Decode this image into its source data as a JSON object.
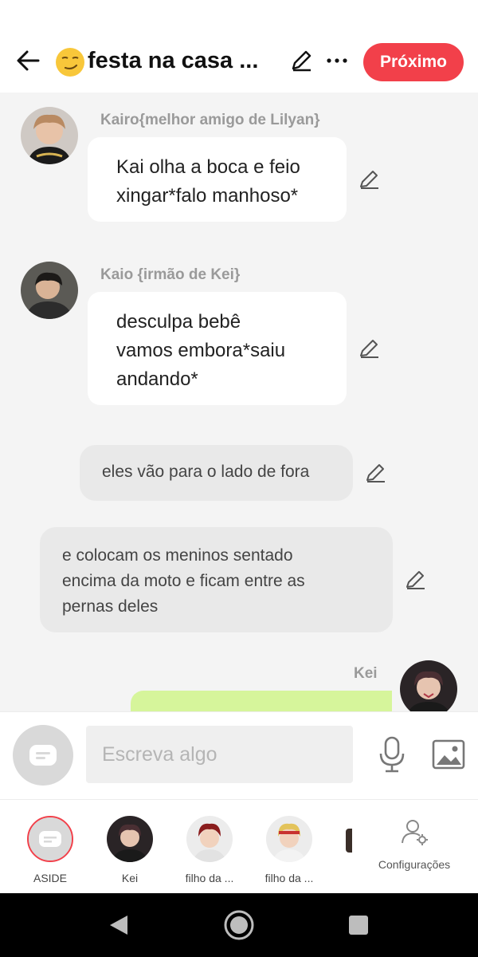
{
  "header": {
    "title": "festa na casa ...",
    "next_label": "Próximo",
    "icons": [
      "back-arrow-icon",
      "smirk-emoji",
      "pencil-icon",
      "more-icon"
    ]
  },
  "messages": [
    {
      "character": "Kairo{melhor amigo de Lilyan}",
      "text_lines": [
        "Kai olha a boca e feio",
        "xingar*falo manhoso*"
      ]
    },
    {
      "character": "Kaio {irmão de Kei}",
      "text_lines": [
        "desculpa bebê",
        "vamos embora*saiu",
        "andando*"
      ]
    }
  ],
  "narrations": [
    {
      "text_lines": [
        "eles vão para o lado de fora"
      ]
    },
    {
      "text_lines": [
        "e colocam os meninos sentado",
        "encima da moto e ficam entre as",
        "pernas deles"
      ]
    }
  ],
  "last_message": {
    "character": "Kei"
  },
  "input": {
    "placeholder": "Escreva algo"
  },
  "characters": [
    {
      "label": "ASIDE"
    },
    {
      "label": "Kei"
    },
    {
      "label": "filho da ..."
    },
    {
      "label": "filho da ..."
    }
  ],
  "settings_label": "Configurações",
  "colors": {
    "accent": "#f2404a",
    "green_bubble": "#d6f59b",
    "background": "#f4f4f4"
  }
}
